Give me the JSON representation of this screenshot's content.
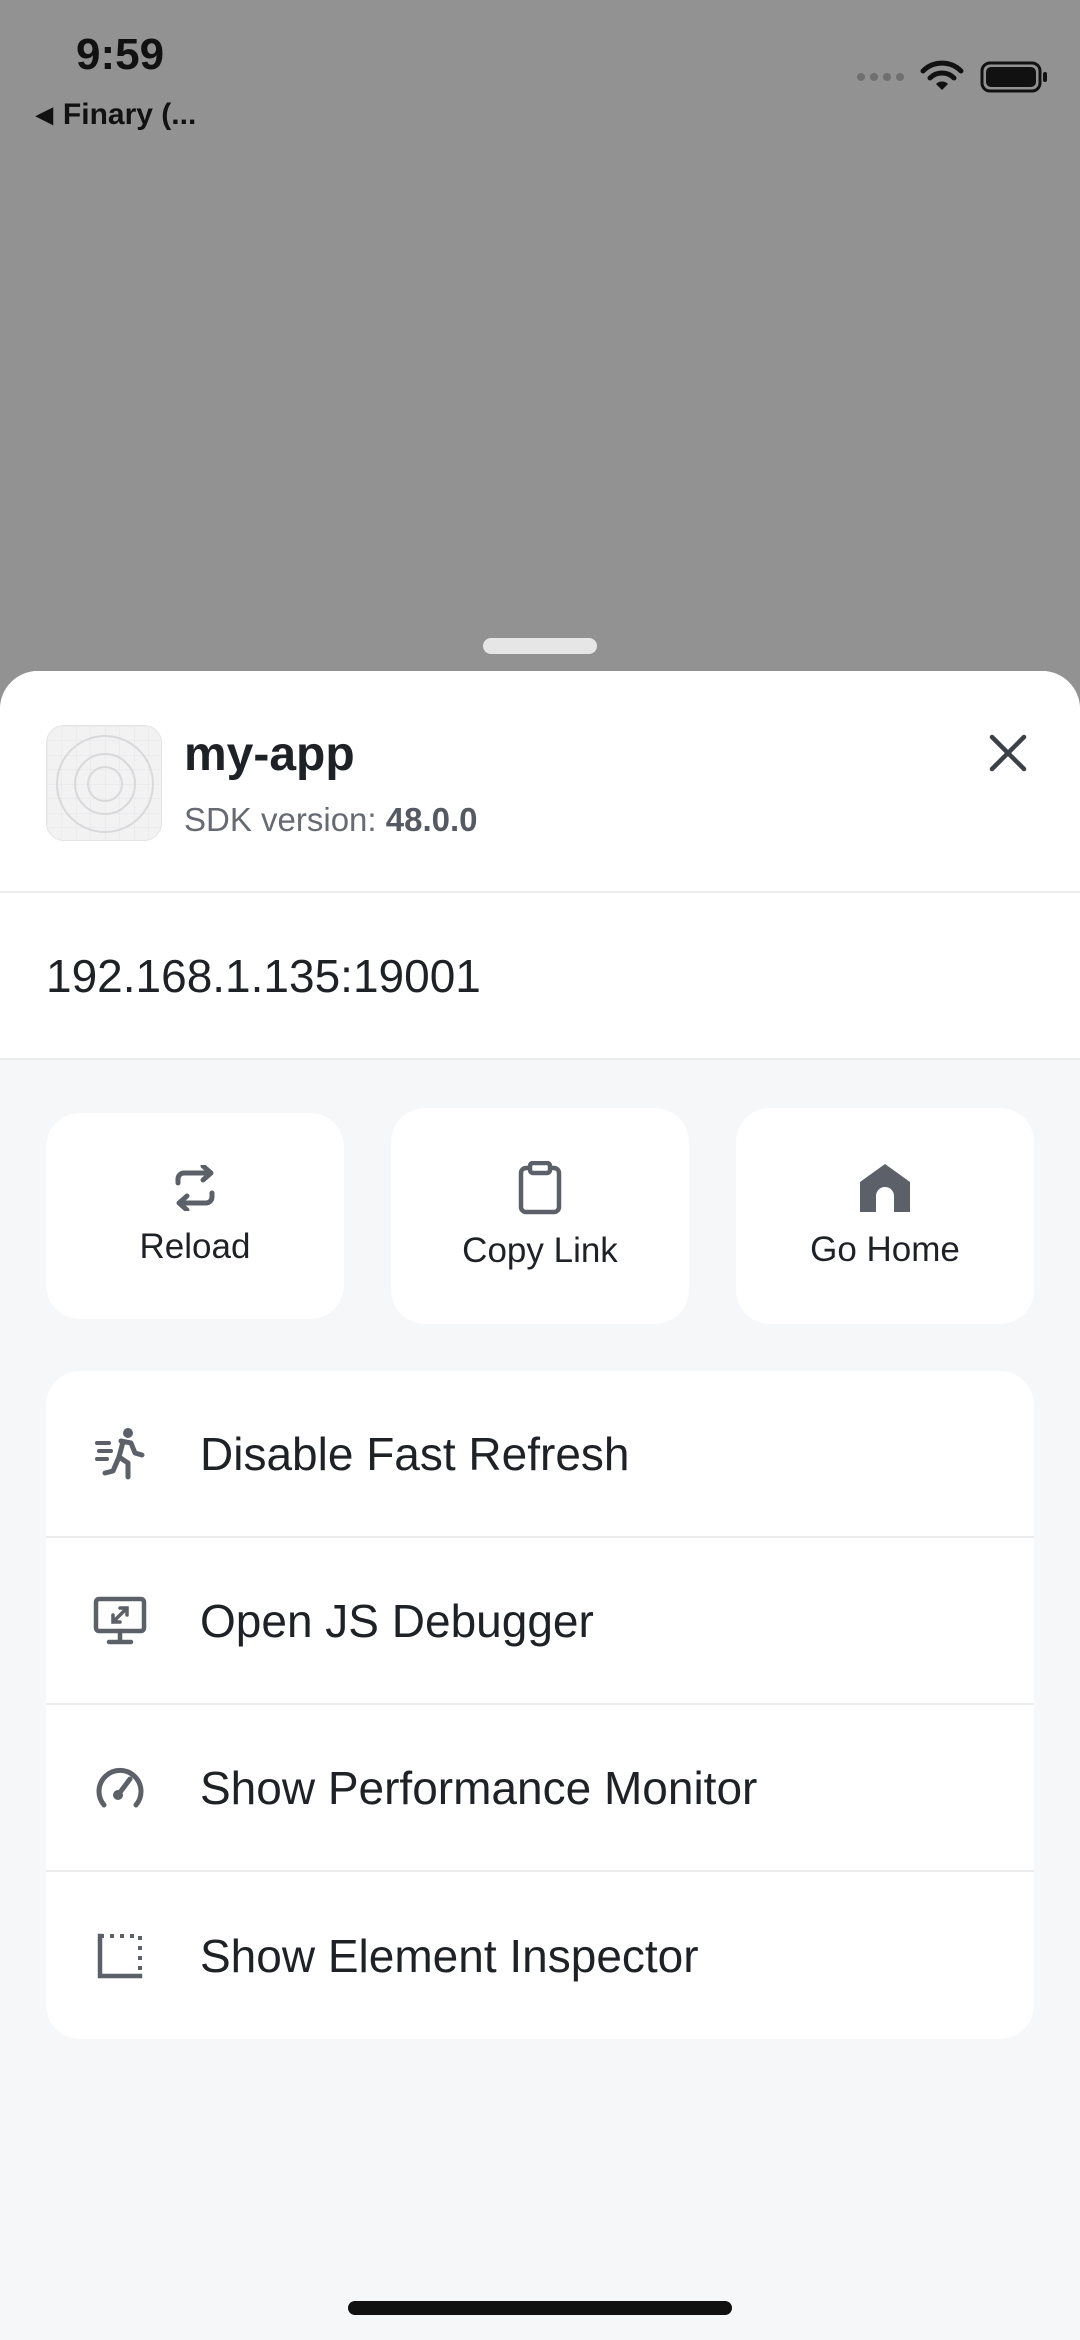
{
  "status_bar": {
    "time": "9:59",
    "back_label": "Finary (...",
    "icons": [
      "cellular-signal-icon",
      "wifi-icon",
      "battery-icon"
    ]
  },
  "sheet": {
    "app_name": "my-app",
    "sdk_prefix": "SDK version:",
    "sdk_version": "48.0.0",
    "url": "192.168.1.135:19001"
  },
  "actions": [
    {
      "label": "Reload",
      "icon": "reload-icon"
    },
    {
      "label": "Copy Link",
      "icon": "clipboard-icon"
    },
    {
      "label": "Go Home",
      "icon": "home-icon"
    }
  ],
  "menu": [
    {
      "label": "Disable Fast Refresh",
      "icon": "running-icon"
    },
    {
      "label": "Open JS Debugger",
      "icon": "monitor-debug-icon"
    },
    {
      "label": "Show Performance Monitor",
      "icon": "speedometer-icon"
    },
    {
      "label": "Show Element Inspector",
      "icon": "inspector-icon"
    }
  ],
  "colors": {
    "backdrop": "#929292",
    "sheet_background": "#f6f7f9",
    "card_background": "#ffffff",
    "icon_gray": "#5c6068",
    "text": "#1e2126"
  }
}
